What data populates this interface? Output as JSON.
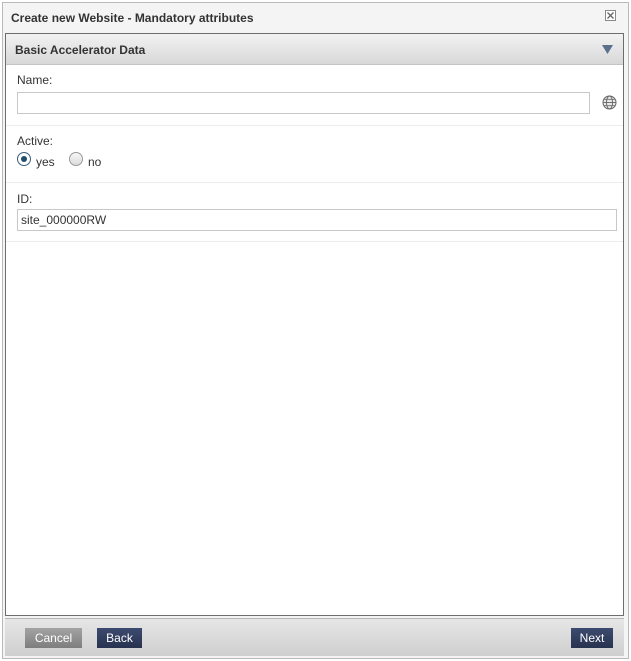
{
  "dialog": {
    "title": "Create new Website - Mandatory attributes"
  },
  "section": {
    "title": "Basic Accelerator Data"
  },
  "fields": {
    "name": {
      "label": "Name:",
      "value": ""
    },
    "active": {
      "label": "Active:",
      "options": [
        {
          "label": "yes",
          "checked": true
        },
        {
          "label": "no",
          "checked": false
        }
      ]
    },
    "id": {
      "label": "ID:",
      "value": "site_000000RW"
    }
  },
  "footer": {
    "cancel_label": "Cancel",
    "back_label": "Back",
    "next_label": "Next"
  },
  "icons": {
    "close": "close-icon",
    "collapse": "triangle-down-icon",
    "localize": "globe-icon"
  },
  "colors": {
    "primary_button": "#27324f",
    "secondary_button": "#8a8a8a",
    "radio_checked": "#1e4d6e"
  }
}
